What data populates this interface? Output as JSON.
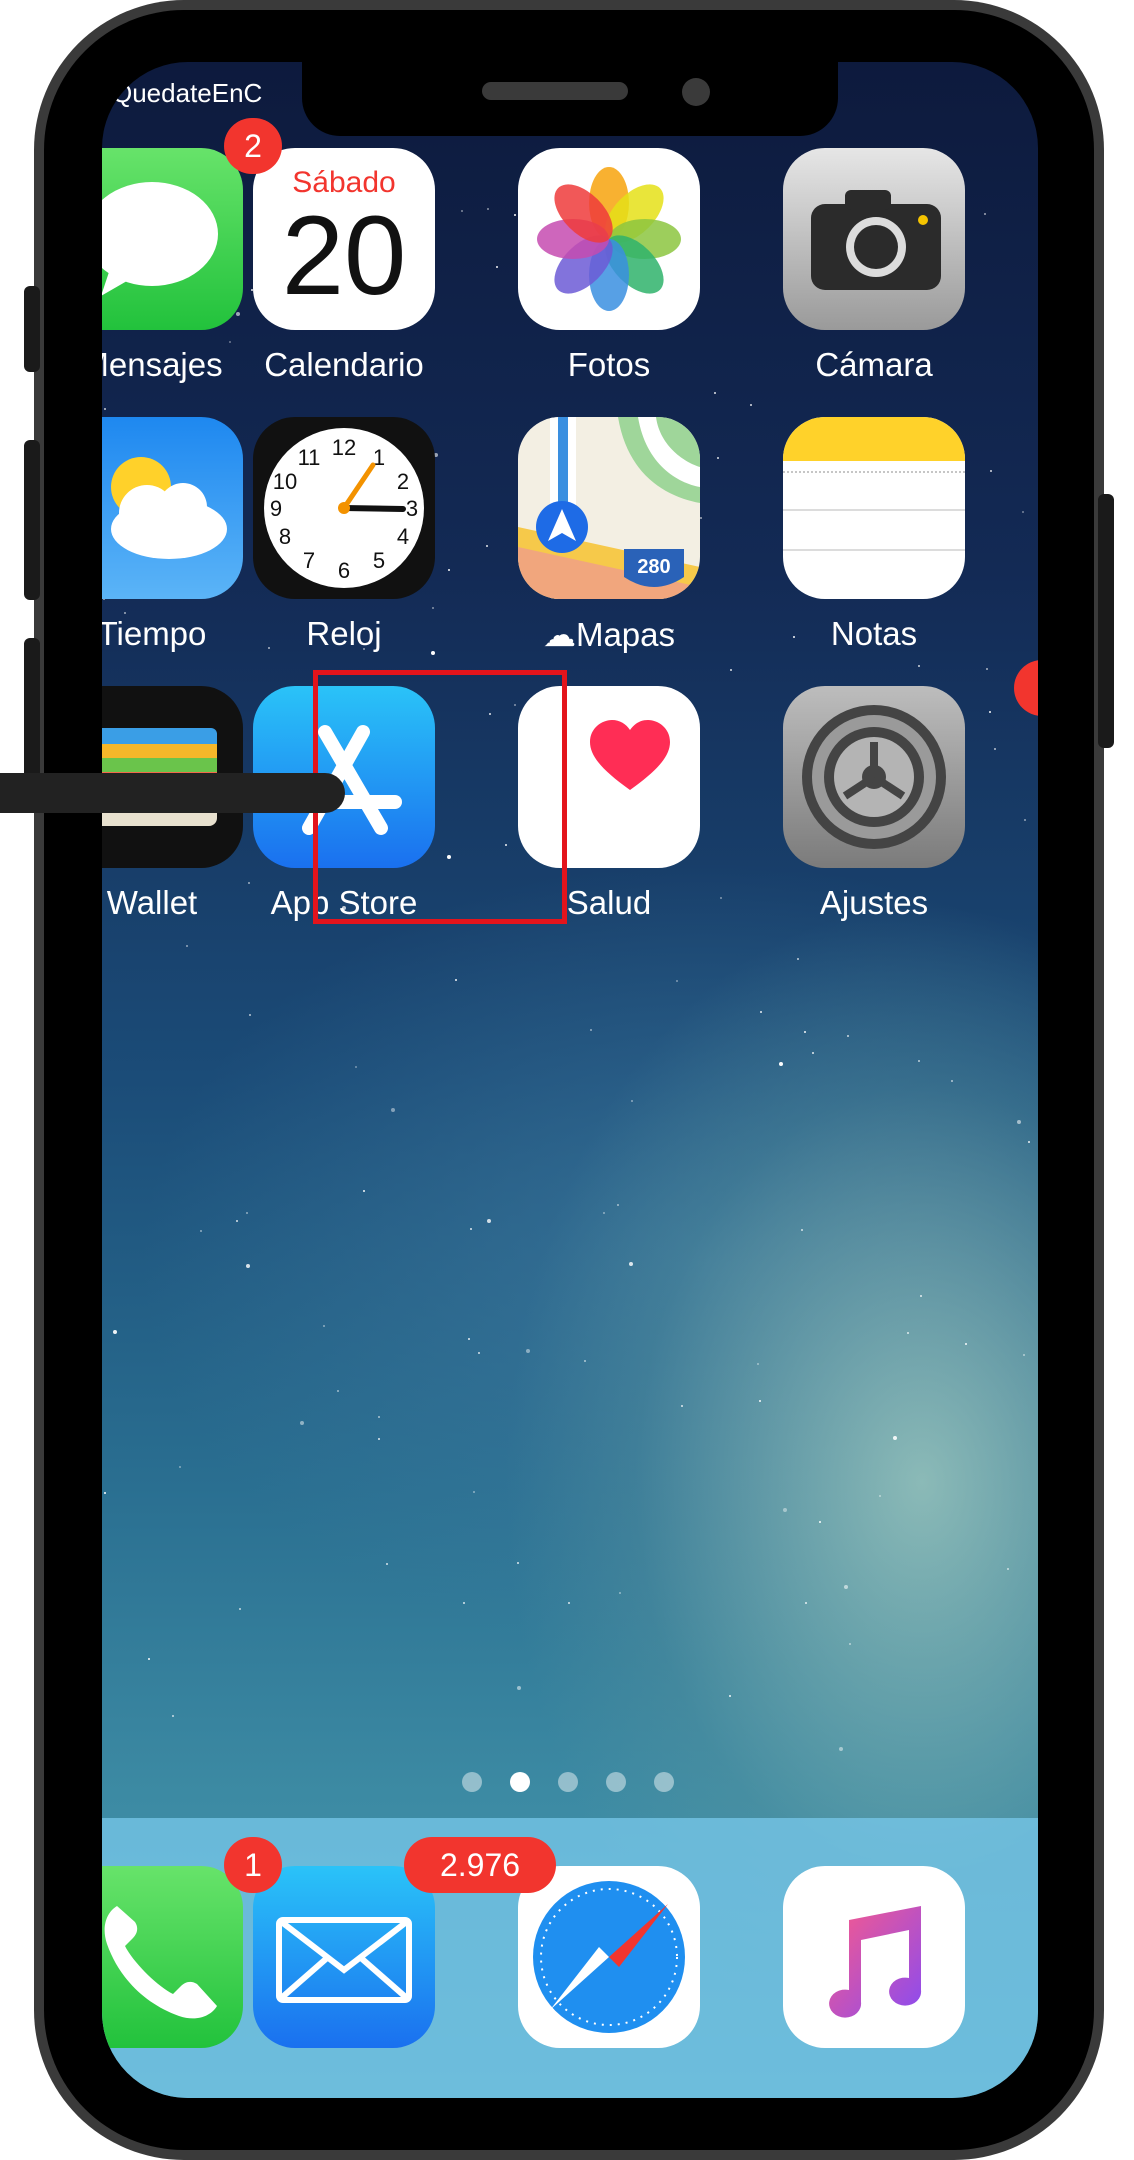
{
  "status_bar": {
    "carrier": "QuedateEnC"
  },
  "apps": [
    {
      "label": "Mensajes",
      "icon": "messages-icon"
    },
    {
      "label": "Calendario",
      "icon": "calendar-icon",
      "weekday": "Sábado",
      "day": "20"
    },
    {
      "label": "Fotos",
      "icon": "photos-icon"
    },
    {
      "label": "Cámara",
      "icon": "camera-icon"
    },
    {
      "label": "Tiempo",
      "icon": "weather-icon"
    },
    {
      "label": "Reloj",
      "icon": "clock-icon",
      "numerals": [
        "12",
        "1",
        "2",
        "3",
        "4",
        "5",
        "6",
        "7",
        "8",
        "9",
        "10",
        "11"
      ]
    },
    {
      "label": "Mapas",
      "icon": "maps-icon",
      "shield": "280"
    },
    {
      "label": "Notas",
      "icon": "notes-icon"
    },
    {
      "label": "Wallet",
      "icon": "wallet-icon"
    },
    {
      "label": "App Store",
      "icon": "app-store-icon"
    },
    {
      "label": "Salud",
      "icon": "health-icon"
    },
    {
      "label": "Ajustes",
      "icon": "settings-icon"
    }
  ],
  "badges": {
    "mensajes": "2",
    "telefono": "1",
    "mail": "2.976"
  },
  "dock": [
    {
      "icon": "phone-icon"
    },
    {
      "icon": "mail-icon"
    },
    {
      "icon": "safari-icon"
    },
    {
      "icon": "music-icon"
    }
  ],
  "page_indicator": {
    "pages": 5,
    "current": 2
  },
  "highlight": {
    "target": "App Store",
    "color": "#e3141c"
  }
}
